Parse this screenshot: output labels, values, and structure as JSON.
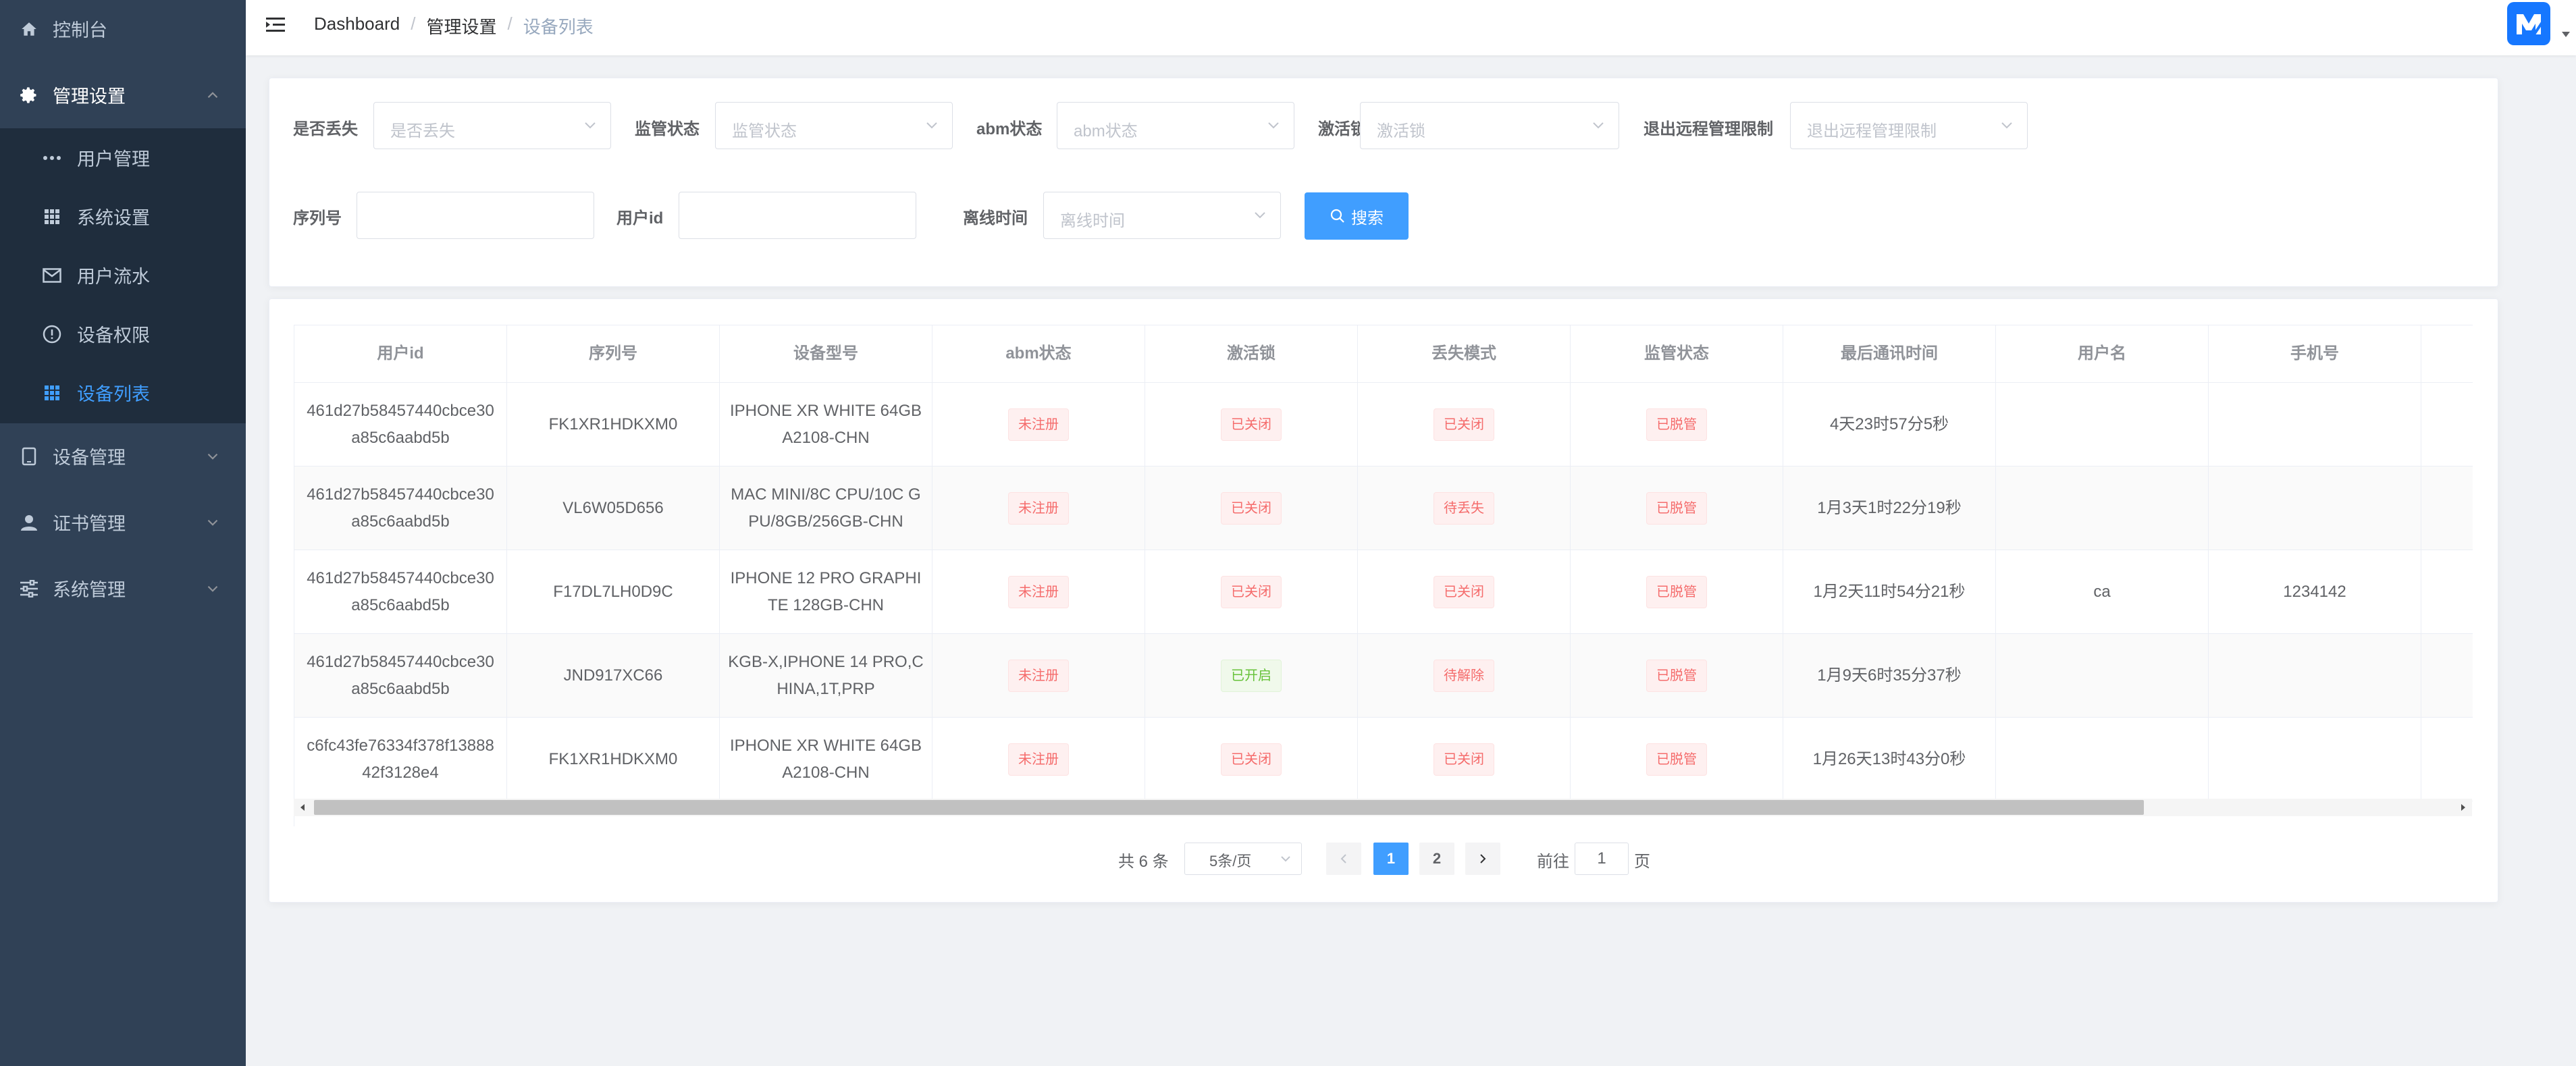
{
  "sidebar": {
    "items": [
      {
        "label": "控制台",
        "icon": "home-icon"
      },
      {
        "label": "管理设置",
        "icon": "gear-icon",
        "expanded": true
      },
      {
        "label": "设备管理",
        "icon": "tablet-icon"
      },
      {
        "label": "证书管理",
        "icon": "user-icon"
      },
      {
        "label": "系统管理",
        "icon": "sliders-icon"
      }
    ],
    "sub_items": [
      {
        "label": "用户管理",
        "icon": "more-dots-icon"
      },
      {
        "label": "系统设置",
        "icon": "grid-icon"
      },
      {
        "label": "用户流水",
        "icon": "mail-icon"
      },
      {
        "label": "设备权限",
        "icon": "info-circle-icon"
      },
      {
        "label": "设备列表",
        "icon": "grid-icon",
        "active": true
      }
    ]
  },
  "header": {
    "breadcrumb": [
      "Dashboard",
      "管理设置",
      "设备列表"
    ],
    "separator": "/"
  },
  "filters": {
    "lost": {
      "label": "是否丢失",
      "placeholder": "是否丢失"
    },
    "supervise": {
      "label": "监管状态",
      "placeholder": "监管状态"
    },
    "abm": {
      "label": "abm状态",
      "placeholder": "abm状态"
    },
    "activation_lock": {
      "label": "激活锁",
      "placeholder": "激活锁"
    },
    "remote_exit": {
      "label": "退出远程管理限制",
      "placeholder": "退出远程管理限制"
    },
    "serial": {
      "label": "序列号",
      "value": ""
    },
    "user_id": {
      "label": "用户id",
      "value": ""
    },
    "offline_time": {
      "label": "离线时间",
      "placeholder": "离线时间"
    },
    "search_button": "搜索"
  },
  "table": {
    "columns": [
      "用户id",
      "序列号",
      "设备型号",
      "abm状态",
      "激活锁",
      "丢失模式",
      "监管状态",
      "最后通讯时间",
      "用户名",
      "手机号"
    ],
    "rows": [
      {
        "user_id": "461d27b58457440cbce30a85c6aabd5b",
        "serial": "FK1XR1HDKXM0",
        "model": "IPHONE XR WHITE 64GB A2108-CHN",
        "abm": "未注册",
        "lock": "已关闭",
        "lost_mode": "已关闭",
        "supervise": "已脱管",
        "last_comm": "4天23时57分5秒",
        "username": "",
        "phone": ""
      },
      {
        "user_id": "461d27b58457440cbce30a85c6aabd5b",
        "serial": "VL6W05D656",
        "model": "MAC MINI/8C CPU/10C GPU/8GB/256GB-CHN",
        "abm": "未注册",
        "lock": "已关闭",
        "lost_mode": "待丢失",
        "supervise": "已脱管",
        "last_comm": "1月3天1时22分19秒",
        "username": "",
        "phone": ""
      },
      {
        "user_id": "461d27b58457440cbce30a85c6aabd5b",
        "serial": "F17DL7LH0D9C",
        "model": "IPHONE 12 PRO GRAPHITE 128GB-CHN",
        "abm": "未注册",
        "lock": "已关闭",
        "lost_mode": "已关闭",
        "supervise": "已脱管",
        "last_comm": "1月2天11时54分21秒",
        "username": "ca",
        "phone": "1234142"
      },
      {
        "user_id": "461d27b58457440cbce30a85c6aabd5b",
        "serial": "JND917XC66",
        "model": "KGB-X,IPHONE 14 PRO,CHINA,1T,PRP",
        "abm": "未注册",
        "lock": "已开启",
        "lost_mode": "待解除",
        "supervise": "已脱管",
        "last_comm": "1月9天6时35分37秒",
        "username": "",
        "phone": ""
      },
      {
        "user_id": "c6fc43fe76334f378f1388842f3128e4",
        "serial": "FK1XR1HDKXM0",
        "model": "IPHONE XR WHITE 64GB A2108-CHN",
        "abm": "未注册",
        "lock": "已关闭",
        "lost_mode": "已关闭",
        "supervise": "已脱管",
        "last_comm": "1月26天13时43分0秒",
        "username": "",
        "phone": ""
      }
    ]
  },
  "pagination": {
    "total_text": "共 6 条",
    "page_size": "5条/页",
    "pages": [
      "1",
      "2"
    ],
    "current": "1",
    "goto_label": "前往",
    "goto_value": "1",
    "page_suffix": "页"
  },
  "colors": {
    "sidebar_bg": "#304156",
    "submenu_bg": "#1f2d3d",
    "accent": "#409eff",
    "danger": "#f56c6c",
    "success": "#67c23a"
  }
}
